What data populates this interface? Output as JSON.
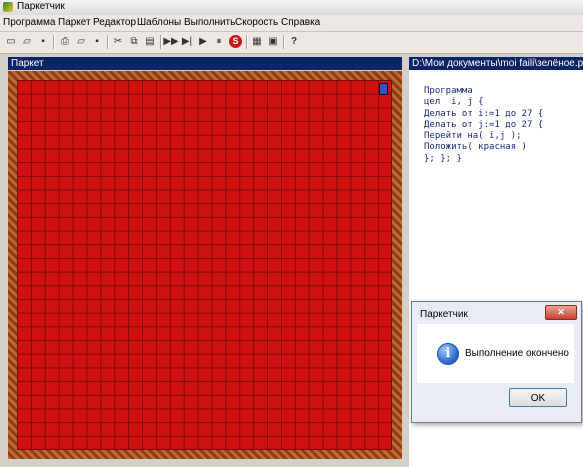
{
  "window": {
    "title": "Паркетчик"
  },
  "menu": [
    "Программа",
    "Паркет",
    "Редактор",
    "Шаблоны",
    "Выполнить",
    "Скорость",
    "Справка"
  ],
  "toolbar": {
    "buttons": [
      {
        "name": "new-file-icon",
        "glyph": "▭"
      },
      {
        "name": "open-file-icon",
        "glyph": "▱"
      },
      {
        "name": "save-file-icon",
        "glyph": "▪"
      },
      {
        "name": "print-icon",
        "glyph": "⎙"
      },
      {
        "name": "open-parquet-icon",
        "glyph": "▱"
      },
      {
        "name": "save-parquet-icon",
        "glyph": "▪"
      },
      {
        "name": "cut-icon",
        "glyph": "✂"
      },
      {
        "name": "copy-icon",
        "glyph": "⧉"
      },
      {
        "name": "paste-icon",
        "glyph": "▤"
      },
      {
        "name": "run-icon",
        "glyph": "▶▶"
      },
      {
        "name": "step-icon",
        "glyph": "▶|"
      },
      {
        "name": "step-over-icon",
        "glyph": "▶"
      },
      {
        "name": "pause-icon",
        "glyph": "⏸"
      },
      {
        "name": "stop-icon",
        "glyph": "S"
      },
      {
        "name": "templates-icon",
        "glyph": "▦"
      },
      {
        "name": "settings-icon",
        "glyph": "▣"
      },
      {
        "name": "help-icon",
        "glyph": "?"
      }
    ]
  },
  "parquet": {
    "header": "Паркет",
    "grid": {
      "rows": 27,
      "cols": 27,
      "tile_color": "#d01010",
      "line_color": "#7a0a0a"
    }
  },
  "editor": {
    "header": "D:\\Мои документы\\moi faili\\зелёное.р",
    "code_lines": [
      "Программа",
      "цел  i, j {",
      "Делать от i:=1 до 27 {",
      "Делать от j:=1 до 27 {",
      "Перейти на( i,j );",
      "Положить( красная )",
      "}; }; }"
    ]
  },
  "dialog": {
    "title": "Паркетчик",
    "message": "Выполнение окончено",
    "ok_label": "OK",
    "close_label": "✕"
  }
}
